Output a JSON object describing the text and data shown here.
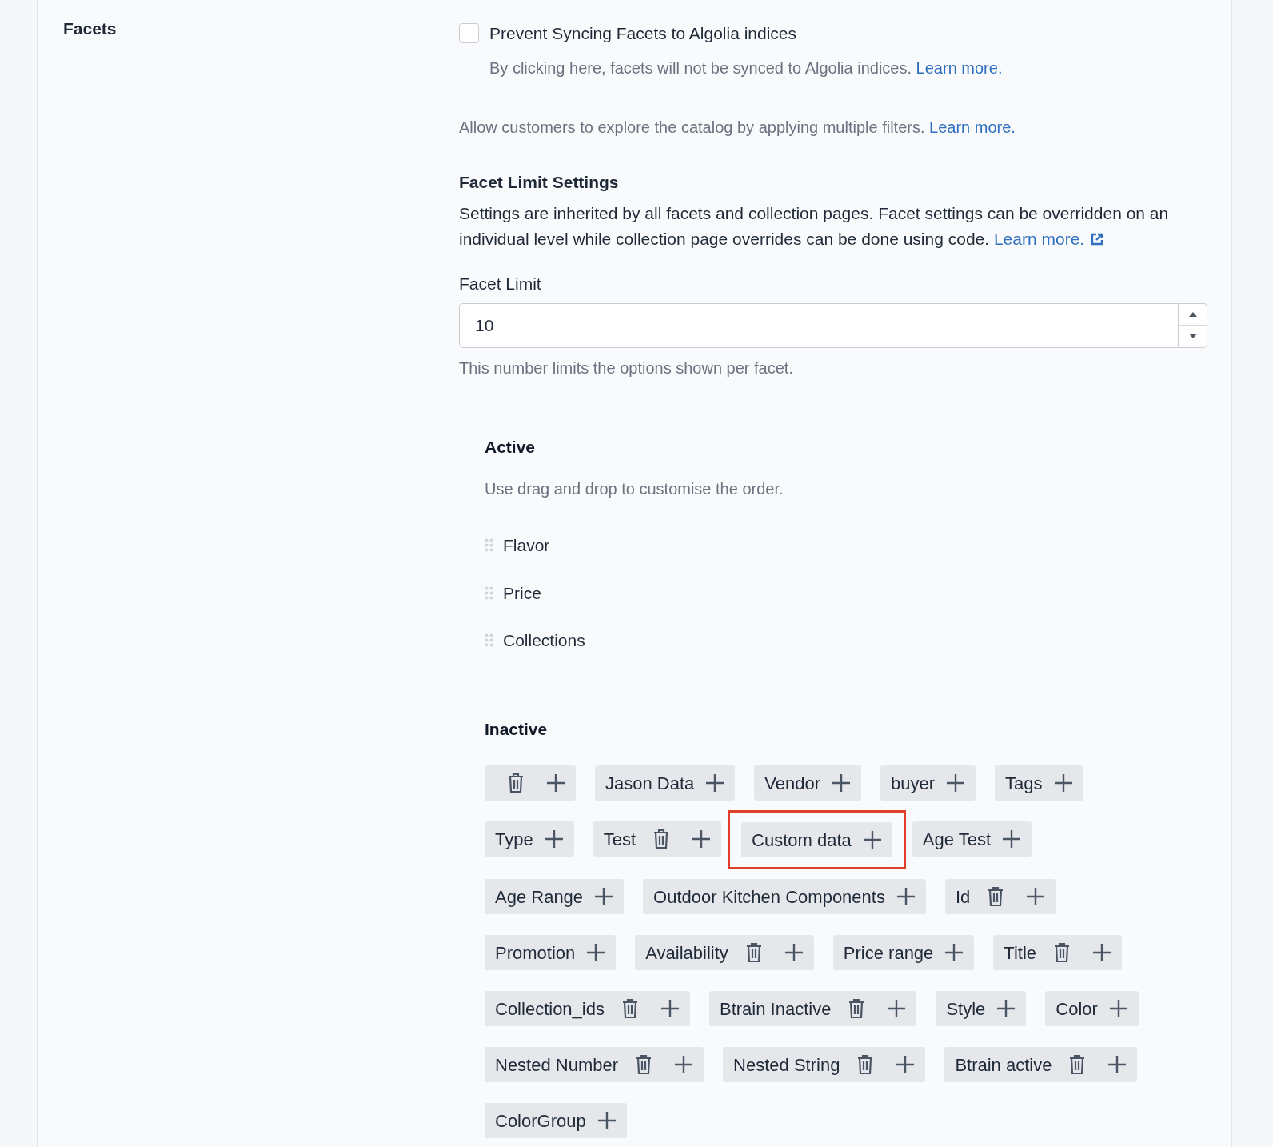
{
  "section": {
    "title": "Facets"
  },
  "sync_option": {
    "label": "Prevent Syncing Facets to Algolia indices",
    "checked": false,
    "help": "By clicking here, facets will not be synced to Algolia indices.",
    "link": "Learn more."
  },
  "intro": {
    "text": "Allow customers to explore the catalog by applying multiple filters.",
    "link": "Learn more."
  },
  "limit_settings": {
    "title": "Facet Limit Settings",
    "text": "Settings are inherited by all facets and collection pages. Facet settings can be overridden on an individual level while collection page overrides can be done using code.",
    "link": "Learn more."
  },
  "facet_limit": {
    "label": "Facet Limit",
    "value": "10",
    "help": "This number limits the options shown per facet."
  },
  "active": {
    "title": "Active",
    "hint": "Use drag and drop to customise the order.",
    "items": [
      "Flavor",
      "Price",
      "Collections"
    ]
  },
  "inactive": {
    "title": "Inactive",
    "chips": [
      {
        "deletable": true,
        "highlighted": false
      },
      {
        "label": "Jason Data",
        "deletable": false,
        "highlighted": false
      },
      {
        "label": "Vendor",
        "deletable": false,
        "highlighted": false
      },
      {
        "label": "buyer",
        "deletable": false,
        "highlighted": false
      },
      {
        "label": "Tags",
        "deletable": false,
        "highlighted": false
      },
      {
        "label": "Type",
        "deletable": false,
        "highlighted": false
      },
      {
        "label": "Test",
        "deletable": true,
        "highlighted": false
      },
      {
        "label": "Custom data",
        "deletable": false,
        "highlighted": true
      },
      {
        "label": "Age Test",
        "deletable": false,
        "highlighted": false
      },
      {
        "label": "Age Range",
        "deletable": false,
        "highlighted": false
      },
      {
        "label": "Outdoor Kitchen Components",
        "deletable": false,
        "highlighted": false
      },
      {
        "label": "Id",
        "deletable": true,
        "highlighted": false
      },
      {
        "label": "Promotion",
        "deletable": false,
        "highlighted": false
      },
      {
        "label": "Availability",
        "deletable": true,
        "highlighted": false
      },
      {
        "label": "Price range",
        "deletable": false,
        "highlighted": false
      },
      {
        "label": "Title",
        "deletable": true,
        "highlighted": false
      },
      {
        "label": "Collection_ids",
        "deletable": true,
        "highlighted": false
      },
      {
        "label": "Btrain Inactive",
        "deletable": true,
        "highlighted": false
      },
      {
        "label": "Style",
        "deletable": false,
        "highlighted": false
      },
      {
        "label": "Color",
        "deletable": false,
        "highlighted": false
      },
      {
        "label": "Nested Number",
        "deletable": true,
        "highlighted": false
      },
      {
        "label": "Nested String",
        "deletable": true,
        "highlighted": false
      },
      {
        "label": "Btrain active",
        "deletable": true,
        "highlighted": false
      },
      {
        "label": "ColorGroup",
        "deletable": false,
        "highlighted": false
      }
    ]
  }
}
